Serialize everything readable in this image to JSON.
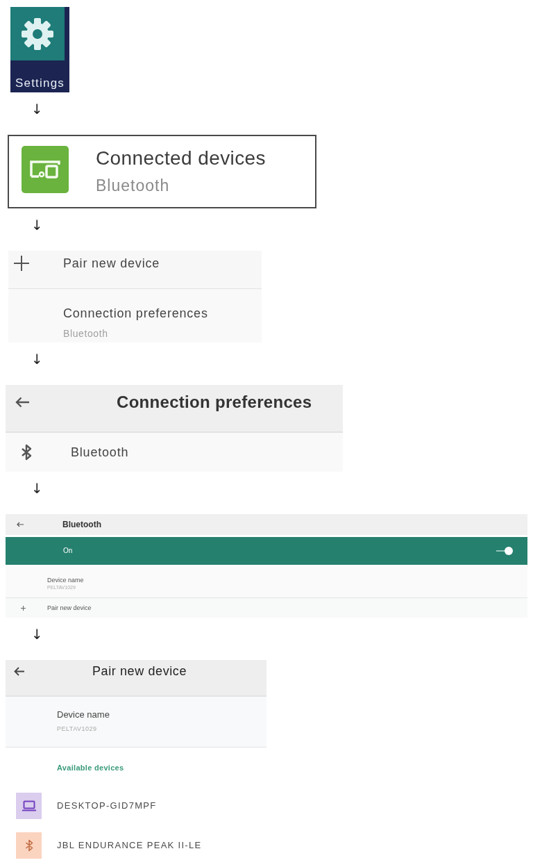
{
  "steps": [
    {
      "kind": "app_icon",
      "label": "Settings"
    },
    {
      "kind": "highlight_item",
      "arrow": "↓",
      "title": "Connected devices",
      "subtitle": "Bluetooth"
    },
    {
      "kind": "menu_list",
      "arrow": "↓",
      "items": [
        {
          "kind": "plus",
          "title": "Pair new device"
        },
        {
          "kind": "plain",
          "title": "Connection preferences",
          "subtitle": "Bluetooth"
        }
      ]
    },
    {
      "kind": "screen",
      "arrow": "↓",
      "title": "Connection preferences",
      "items": [
        {
          "kind": "bluetooth",
          "title": "Bluetooth"
        }
      ]
    },
    {
      "kind": "bluetooth_screen",
      "arrow": "↓",
      "title": "Bluetooth",
      "toggle": {
        "label": "On",
        "on": true
      },
      "items": [
        {
          "kind": "plain",
          "title": "Device name",
          "subtitle": "PELTAV1029"
        },
        {
          "kind": "plus",
          "title": "Pair new device"
        }
      ]
    },
    {
      "kind": "pair_screen",
      "arrow": "↓",
      "title": "Pair new device",
      "device_name": {
        "title": "Device name",
        "subtitle": "PELTAV1029"
      },
      "section_title": "Available devices",
      "devices": [
        {
          "kind": "laptop",
          "name": "DESKTOP-GID7MPF",
          "color": "#dacdee"
        },
        {
          "kind": "bluetooth",
          "name": "JBL ENDURANCE PEAK II-LE",
          "color": "#fbd4c0"
        }
      ]
    }
  ]
}
